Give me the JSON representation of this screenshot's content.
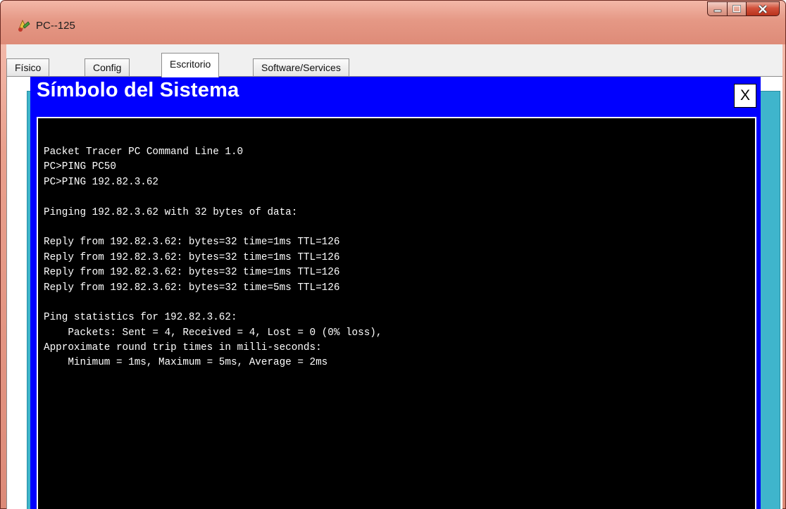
{
  "window": {
    "title": "PC--125",
    "icon": "packet-tracer-pc-icon",
    "controls": [
      "minimize-icon",
      "maximize-icon",
      "close-icon"
    ]
  },
  "tabs": [
    {
      "label": "Físico"
    },
    {
      "label": "Config"
    },
    {
      "label": "Escritorio"
    },
    {
      "label": "Software/Services"
    }
  ],
  "active_tab": "Escritorio",
  "command_prompt": {
    "title": "Símbolo del Sistema",
    "close_label": "X",
    "lines": [
      "Packet Tracer PC Command Line 1.0",
      "PC>PING PC50",
      "PC>PING 192.82.3.62",
      "",
      "Pinging 192.82.3.62 with 32 bytes of data:",
      "",
      "Reply from 192.82.3.62: bytes=32 time=1ms TTL=126",
      "Reply from 192.82.3.62: bytes=32 time=1ms TTL=126",
      "Reply from 192.82.3.62: bytes=32 time=1ms TTL=126",
      "Reply from 192.82.3.62: bytes=32 time=5ms TTL=126",
      "",
      "Ping statistics for 192.82.3.62:",
      "    Packets: Sent = 4, Received = 4, Lost = 0 (0% loss),",
      "Approximate round trip times in milli-seconds:",
      "    Minimum = 1ms, Maximum = 5ms, Average = 2ms"
    ]
  },
  "colors": {
    "frame": "#e29584",
    "desktop": "#3fb5cc",
    "cmd_titlebar": "#0000ff",
    "terminal_bg": "#000000",
    "terminal_fg": "#ffffff"
  }
}
